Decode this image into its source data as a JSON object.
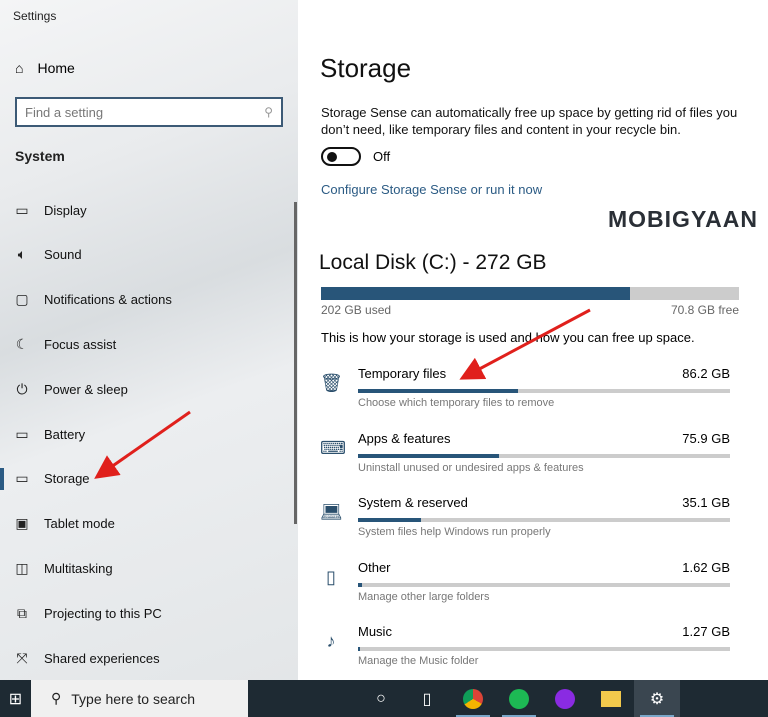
{
  "app_title": "Settings",
  "sidebar": {
    "home": "Home",
    "search_placeholder": "Find a setting",
    "section": "System",
    "items": [
      {
        "label": "Display",
        "icon": "monitor-icon"
      },
      {
        "label": "Sound",
        "icon": "speaker-icon"
      },
      {
        "label": "Notifications & actions",
        "icon": "notification-icon"
      },
      {
        "label": "Focus assist",
        "icon": "moon-icon"
      },
      {
        "label": "Power & sleep",
        "icon": "power-icon"
      },
      {
        "label": "Battery",
        "icon": "battery-icon"
      },
      {
        "label": "Storage",
        "icon": "storage-icon",
        "selected": true
      },
      {
        "label": "Tablet mode",
        "icon": "tablet-icon"
      },
      {
        "label": "Multitasking",
        "icon": "multitasking-icon"
      },
      {
        "label": "Projecting to this PC",
        "icon": "projector-icon"
      },
      {
        "label": "Shared experiences",
        "icon": "shared-icon"
      }
    ]
  },
  "main": {
    "title": "Storage",
    "description": "Storage Sense can automatically free up space by getting rid of files you don’t need, like temporary files and content in your recycle bin.",
    "toggle_state": "Off",
    "link": "Configure Storage Sense or run it now",
    "watermark": "MOBIGYAAN",
    "disk": {
      "title": "Local Disk (C:) - 272 GB",
      "used": "202 GB used",
      "free": "70.8 GB free",
      "used_fraction": 0.74
    },
    "how_text": "This is how your storage is used and how you can free up space.",
    "categories": [
      {
        "name": "Temporary files",
        "size": "86.2 GB",
        "sub": "Choose which temporary files to remove",
        "fraction": 0.43,
        "icon": "trash-icon"
      },
      {
        "name": "Apps & features",
        "size": "75.9 GB",
        "sub": "Uninstall unused or undesired apps & features",
        "fraction": 0.38,
        "icon": "apps-icon"
      },
      {
        "name": "System & reserved",
        "size": "35.1 GB",
        "sub": "System files help Windows run properly",
        "fraction": 0.17,
        "icon": "laptop-icon"
      },
      {
        "name": "Other",
        "size": "1.62 GB",
        "sub": "Manage other large folders",
        "fraction": 0.01,
        "icon": "folder-icon"
      },
      {
        "name": "Music",
        "size": "1.27 GB",
        "sub": "Manage the Music folder",
        "fraction": 0.006,
        "icon": "music-icon"
      }
    ]
  },
  "taskbar": {
    "search_placeholder": "Type here to search"
  }
}
